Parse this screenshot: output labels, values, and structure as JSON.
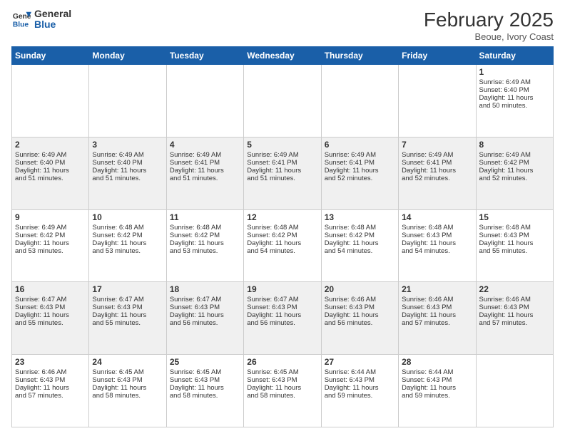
{
  "header": {
    "logo_line1": "General",
    "logo_line2": "Blue",
    "month": "February 2025",
    "location": "Beoue, Ivory Coast"
  },
  "days_of_week": [
    "Sunday",
    "Monday",
    "Tuesday",
    "Wednesday",
    "Thursday",
    "Friday",
    "Saturday"
  ],
  "weeks": [
    [
      {
        "day": "",
        "info": ""
      },
      {
        "day": "",
        "info": ""
      },
      {
        "day": "",
        "info": ""
      },
      {
        "day": "",
        "info": ""
      },
      {
        "day": "",
        "info": ""
      },
      {
        "day": "",
        "info": ""
      },
      {
        "day": "1",
        "info": "Sunrise: 6:49 AM\nSunset: 6:40 PM\nDaylight: 11 hours\nand 50 minutes."
      }
    ],
    [
      {
        "day": "2",
        "info": "Sunrise: 6:49 AM\nSunset: 6:40 PM\nDaylight: 11 hours\nand 51 minutes."
      },
      {
        "day": "3",
        "info": "Sunrise: 6:49 AM\nSunset: 6:40 PM\nDaylight: 11 hours\nand 51 minutes."
      },
      {
        "day": "4",
        "info": "Sunrise: 6:49 AM\nSunset: 6:41 PM\nDaylight: 11 hours\nand 51 minutes."
      },
      {
        "day": "5",
        "info": "Sunrise: 6:49 AM\nSunset: 6:41 PM\nDaylight: 11 hours\nand 51 minutes."
      },
      {
        "day": "6",
        "info": "Sunrise: 6:49 AM\nSunset: 6:41 PM\nDaylight: 11 hours\nand 52 minutes."
      },
      {
        "day": "7",
        "info": "Sunrise: 6:49 AM\nSunset: 6:41 PM\nDaylight: 11 hours\nand 52 minutes."
      },
      {
        "day": "8",
        "info": "Sunrise: 6:49 AM\nSunset: 6:42 PM\nDaylight: 11 hours\nand 52 minutes."
      }
    ],
    [
      {
        "day": "9",
        "info": "Sunrise: 6:49 AM\nSunset: 6:42 PM\nDaylight: 11 hours\nand 53 minutes."
      },
      {
        "day": "10",
        "info": "Sunrise: 6:48 AM\nSunset: 6:42 PM\nDaylight: 11 hours\nand 53 minutes."
      },
      {
        "day": "11",
        "info": "Sunrise: 6:48 AM\nSunset: 6:42 PM\nDaylight: 11 hours\nand 53 minutes."
      },
      {
        "day": "12",
        "info": "Sunrise: 6:48 AM\nSunset: 6:42 PM\nDaylight: 11 hours\nand 54 minutes."
      },
      {
        "day": "13",
        "info": "Sunrise: 6:48 AM\nSunset: 6:42 PM\nDaylight: 11 hours\nand 54 minutes."
      },
      {
        "day": "14",
        "info": "Sunrise: 6:48 AM\nSunset: 6:43 PM\nDaylight: 11 hours\nand 54 minutes."
      },
      {
        "day": "15",
        "info": "Sunrise: 6:48 AM\nSunset: 6:43 PM\nDaylight: 11 hours\nand 55 minutes."
      }
    ],
    [
      {
        "day": "16",
        "info": "Sunrise: 6:47 AM\nSunset: 6:43 PM\nDaylight: 11 hours\nand 55 minutes."
      },
      {
        "day": "17",
        "info": "Sunrise: 6:47 AM\nSunset: 6:43 PM\nDaylight: 11 hours\nand 55 minutes."
      },
      {
        "day": "18",
        "info": "Sunrise: 6:47 AM\nSunset: 6:43 PM\nDaylight: 11 hours\nand 56 minutes."
      },
      {
        "day": "19",
        "info": "Sunrise: 6:47 AM\nSunset: 6:43 PM\nDaylight: 11 hours\nand 56 minutes."
      },
      {
        "day": "20",
        "info": "Sunrise: 6:46 AM\nSunset: 6:43 PM\nDaylight: 11 hours\nand 56 minutes."
      },
      {
        "day": "21",
        "info": "Sunrise: 6:46 AM\nSunset: 6:43 PM\nDaylight: 11 hours\nand 57 minutes."
      },
      {
        "day": "22",
        "info": "Sunrise: 6:46 AM\nSunset: 6:43 PM\nDaylight: 11 hours\nand 57 minutes."
      }
    ],
    [
      {
        "day": "23",
        "info": "Sunrise: 6:46 AM\nSunset: 6:43 PM\nDaylight: 11 hours\nand 57 minutes."
      },
      {
        "day": "24",
        "info": "Sunrise: 6:45 AM\nSunset: 6:43 PM\nDaylight: 11 hours\nand 58 minutes."
      },
      {
        "day": "25",
        "info": "Sunrise: 6:45 AM\nSunset: 6:43 PM\nDaylight: 11 hours\nand 58 minutes."
      },
      {
        "day": "26",
        "info": "Sunrise: 6:45 AM\nSunset: 6:43 PM\nDaylight: 11 hours\nand 58 minutes."
      },
      {
        "day": "27",
        "info": "Sunrise: 6:44 AM\nSunset: 6:43 PM\nDaylight: 11 hours\nand 59 minutes."
      },
      {
        "day": "28",
        "info": "Sunrise: 6:44 AM\nSunset: 6:43 PM\nDaylight: 11 hours\nand 59 minutes."
      },
      {
        "day": "",
        "info": ""
      }
    ]
  ]
}
